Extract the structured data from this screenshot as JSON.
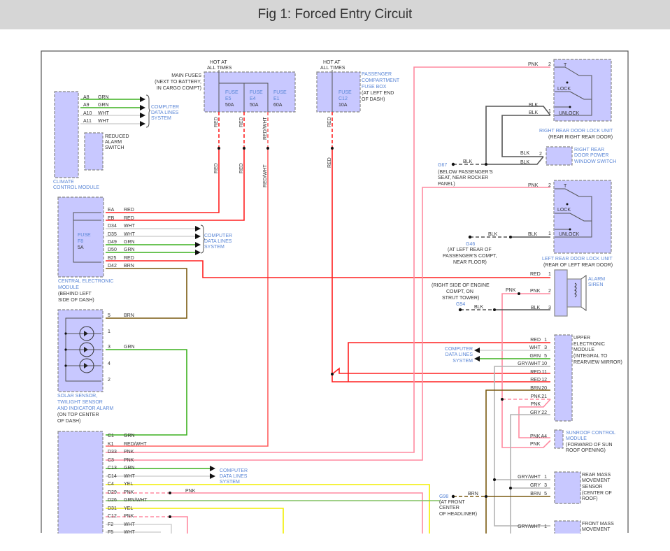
{
  "title": "Fig 1: Forced Entry Circuit",
  "hot_at_all_times": [
    "HOT AT",
    "ALL TIMES"
  ],
  "computer_data_lines": [
    "COMPUTER",
    "DATA LINES",
    "SYSTEM"
  ],
  "climate": {
    "pins": [
      "A8",
      "A9",
      "A10",
      "A11"
    ],
    "colors": [
      "GRN",
      "GRN",
      "WHT",
      "WHT"
    ],
    "label": [
      "CLIMATE",
      "CONTROL MODULE"
    ]
  },
  "reduced_alarm": [
    "REDUCED",
    "ALARM",
    "SWITCH"
  ],
  "main_fuses": {
    "label": [
      "MAIN FUSES",
      "(NEXT TO BATTERY,",
      "IN CARGO COMPT)"
    ],
    "fuses": [
      [
        "FUSE",
        "E5",
        "50A"
      ],
      [
        "FUSE",
        "E4",
        "50A"
      ],
      [
        "FUSE",
        "E1",
        "60A"
      ]
    ],
    "wire_colors": [
      "RED",
      "RED",
      "RED/WHT"
    ]
  },
  "pass_fuse": {
    "label": [
      "PASSENGER",
      "COMPARTMENT",
      "FUSE BOX",
      "(AT LEFT END",
      "OF DASH)"
    ],
    "fuse": [
      "FUSE",
      "C12",
      "10A"
    ],
    "wire_color": "RED"
  },
  "cem": {
    "pins": [
      "EA",
      "EB",
      "D34",
      "D35",
      "D49",
      "D50",
      "B25",
      "D42"
    ],
    "colors": [
      "RED",
      "RED",
      "WHT",
      "WHT",
      "GRN",
      "GRN",
      "RED",
      "BRN"
    ],
    "fuse": [
      "FUSE",
      "F8",
      "5A"
    ],
    "label": [
      "CENTRAL ELECTRONIC",
      "MODULE"
    ],
    "location": [
      "(BEHIND LEFT",
      "SIDE OF DASH)"
    ]
  },
  "solar": {
    "pins": [
      "5",
      "1",
      "3",
      "4",
      "2"
    ],
    "colors": [
      "BRN",
      "GRN"
    ],
    "label": [
      "SOLAR SENSOR,",
      "TWILIGHT SENSOR",
      "AND INDICATOR ALARM"
    ],
    "location": [
      "(ON TOP CENTER",
      "OF DASH)"
    ]
  },
  "bottom_module": {
    "pins": [
      "C1",
      "K1",
      "D33",
      "C3",
      "C13",
      "C14",
      "C4",
      "D29",
      "D26",
      "D31",
      "C12",
      "F2",
      "F5"
    ],
    "colors": [
      "GRN",
      "RED/WHT",
      "PNK",
      "PNK",
      "GRN",
      "WHT",
      "YEL",
      "PNK",
      "GRN/WHT",
      "YEL",
      "PNK",
      "WHT",
      "WHT"
    ],
    "splice_color": "PNK"
  },
  "rr_lock": {
    "pins": [
      "2",
      "1"
    ],
    "switch_labels": [
      "T",
      "LOCK",
      "UNLOCK"
    ],
    "colors": [
      "PNK",
      "BLK",
      "BLK"
    ],
    "label": "RIGHT REAR DOOR LOCK UNIT",
    "location": "(REAR RIGHT REAR DOOR)"
  },
  "rr_window": {
    "pin": "2",
    "colors": [
      "BLK",
      "BLK"
    ],
    "label": [
      "RIGHT REAR",
      "DOOR POWER",
      "WINDOW SWITCH"
    ]
  },
  "g67": {
    "id": "G67",
    "color": "BLK",
    "location": [
      "(BELOW PASSENGER'S",
      "SEAT, NEAR ROCKER",
      "PANEL)"
    ]
  },
  "lr_lock": {
    "pins": [
      "2",
      "1"
    ],
    "switch_labels": [
      "T",
      "LOCK",
      "UNLOCK"
    ],
    "colors": [
      "PNK",
      "BLK"
    ],
    "label": "LEFT REAR DOOR LOCK UNIT",
    "location": "(REAR OF LEFT REAR DOOR)"
  },
  "g46": {
    "id": "G46",
    "color": "BLK",
    "location": [
      "(AT LEFT REAR OF",
      "PASSENGER'S COMPT,",
      "NEAR FLOOR)"
    ]
  },
  "siren": {
    "pins": [
      "1",
      "2",
      "3"
    ],
    "colors": [
      "RED",
      "PNK",
      "BLK"
    ],
    "splice_color": "PNK",
    "label": [
      "ALARM",
      "SIREN"
    ]
  },
  "g94": {
    "id": "G94",
    "color": "BLK",
    "location": [
      "(RIGHT SIDE OF ENGINE",
      "COMPT, ON",
      "STRUT TOWER)"
    ]
  },
  "uem": {
    "pins": [
      "1",
      "3",
      "5",
      "10",
      "11",
      "12",
      "20",
      "21",
      "22"
    ],
    "colors": [
      "RED",
      "WHT",
      "GRN",
      "GRY/WHT",
      "RED",
      "RED",
      "BRN",
      "PNK",
      "GRY"
    ],
    "extra_color": "PNK",
    "label": [
      "UPPER",
      "ELECTRONIC",
      "MODULE",
      "(INTEGRAL TO",
      "REARVIEW MIRROR)"
    ]
  },
  "sunroof": {
    "pin": "A4",
    "colors": [
      "PNK",
      "PNK"
    ],
    "label": [
      "SUNROOF CONTROL",
      "MODULE"
    ],
    "location": [
      "(FORWARD OF SUN",
      "ROOF OPENING)"
    ]
  },
  "rear_mass": {
    "pins": [
      "1",
      "3",
      "5"
    ],
    "colors": [
      "GRY/WHT",
      "GRY",
      "BRN"
    ],
    "label": [
      "REAR MASS",
      "MOVEMENT",
      "SENSOR",
      "(CENTER OF",
      "ROOF)"
    ]
  },
  "g98": {
    "id": "G98",
    "color": "BRN",
    "location": [
      "(AT FRONT",
      "CENTER",
      "OF HEADLINER)"
    ]
  },
  "front_mass": {
    "pins": [
      "1"
    ],
    "colors": [
      "GRY/WHT"
    ],
    "label": [
      "FRONT MASS",
      "MOVEMENT"
    ]
  }
}
